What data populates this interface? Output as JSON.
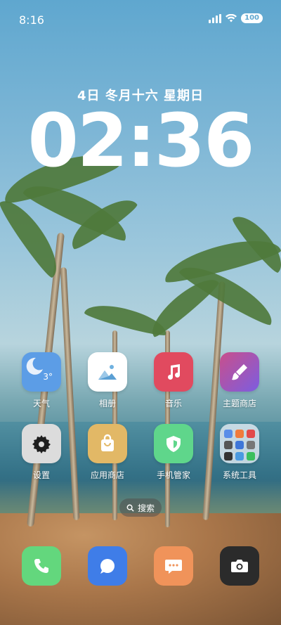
{
  "status_bar": {
    "time": "8:16",
    "battery": "100"
  },
  "lockscreen": {
    "date": "4日 冬月十六  星期日",
    "clock": "02:36"
  },
  "apps_row1": [
    {
      "name": "weather",
      "label": "天气",
      "temp": "3°"
    },
    {
      "name": "gallery",
      "label": "相册"
    },
    {
      "name": "music",
      "label": "音乐"
    },
    {
      "name": "themes",
      "label": "主题商店"
    }
  ],
  "apps_row2": [
    {
      "name": "settings",
      "label": "设置"
    },
    {
      "name": "app-store",
      "label": "应用商店"
    },
    {
      "name": "security",
      "label": "手机管家"
    },
    {
      "name": "system-tools",
      "label": "系统工具"
    }
  ],
  "search": {
    "label": "搜索"
  },
  "dock": [
    "phone",
    "messages-bubble",
    "sms",
    "camera"
  ],
  "colors": {
    "weather": "#5c9de6",
    "gallery": "#ffffff",
    "music": "#e14a5f",
    "themes": "#8f5fdc",
    "settings": "#dcdcdc",
    "app_store": "#e2b866",
    "security": "#5fd68b",
    "folder": "#c9d5dd",
    "phone": "#63d77d",
    "messages": "#3f7de8",
    "sms": "#f0935a",
    "camera": "#2b2b2b"
  }
}
